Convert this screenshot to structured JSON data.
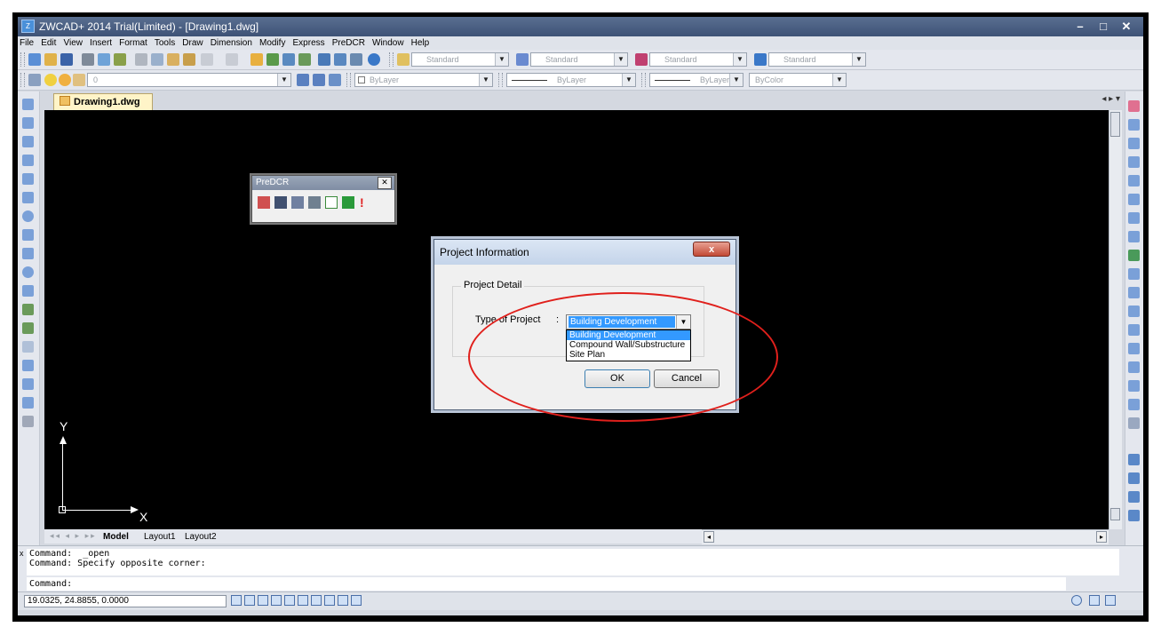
{
  "window": {
    "title": "ZWCAD+ 2014 Trial(Limited) - [Drawing1.dwg]",
    "app_icon": "Z",
    "controls": [
      "–",
      "□",
      "✕"
    ]
  },
  "menu": [
    "File",
    "Edit",
    "View",
    "Insert",
    "Format",
    "Tools",
    "Draw",
    "Dimension",
    "Modify",
    "Express",
    "PreDCR",
    "Window",
    "Help"
  ],
  "toolbar": {
    "text_style": "Standard",
    "dim_style": "Standard",
    "table_style": "Standard",
    "multileader_style": "Standard",
    "layer": "0",
    "color": "ByLayer",
    "linetype": "ByLayer",
    "lineweight": "ByLayer",
    "plotstyle": "ByColor"
  },
  "document_tab": {
    "label": "Drawing1.dwg",
    "nav": "◂ ▸ ▾"
  },
  "canvas": {
    "background": "#000000",
    "ucs_y": "Y",
    "ucs_x": "X"
  },
  "predcr_toolbar": {
    "title": "PreDCR",
    "close": "✕"
  },
  "dialog": {
    "title": "Project Information",
    "close": "x",
    "group_label": "Project Detail",
    "type_label": "Type of Project",
    "colon": ":",
    "selected_value": "Building Development",
    "options": [
      "Building Development",
      "Compound Wall/Substructure",
      "Site Plan"
    ],
    "ok_label": "OK",
    "cancel_label": "Cancel"
  },
  "layout_tabs": {
    "nav": "◂◂ ◂ ▸ ▸▸",
    "model": "Model",
    "layout1": "Layout1",
    "layout2": "Layout2"
  },
  "command": {
    "history_line1": "Command:  _open",
    "history_line2": "Command: Specify opposite corner:",
    "prompt": "Command:",
    "close": "x"
  },
  "status": {
    "coordinates": "19.0325, 24.8855, 0.0000"
  },
  "annotation": {
    "color": "#e0201c"
  },
  "colors": {
    "title_bar": "#3d5276",
    "selection": "#3399ff",
    "tab_active": "#fff4c8"
  }
}
